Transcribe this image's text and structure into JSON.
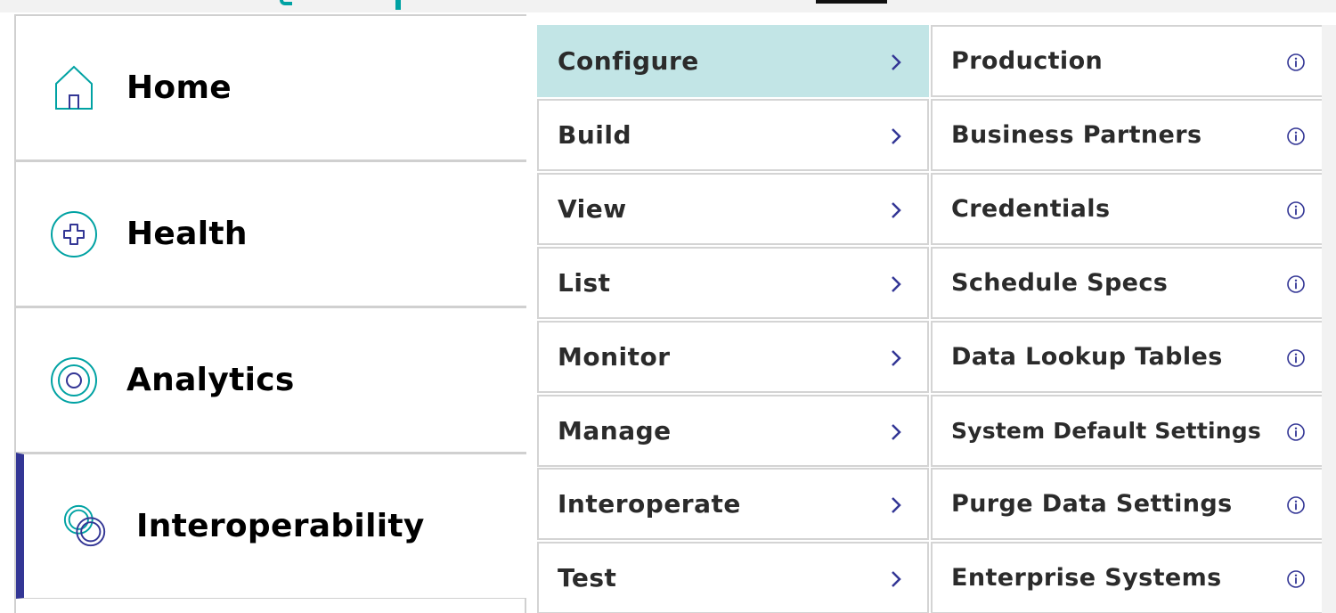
{
  "left_nav": {
    "items": [
      {
        "label": "Home",
        "icon": "home-icon",
        "active": false
      },
      {
        "label": "Health",
        "icon": "health-plus-icon",
        "active": false
      },
      {
        "label": "Analytics",
        "icon": "analytics-target-icon",
        "active": false
      },
      {
        "label": "Interoperability",
        "icon": "interoperability-rings-icon",
        "active": true
      }
    ],
    "active_indicator_color": "#333695"
  },
  "menu": {
    "items": [
      {
        "label": "Configure",
        "selected": true
      },
      {
        "label": "Build",
        "selected": false
      },
      {
        "label": "View",
        "selected": false
      },
      {
        "label": "List",
        "selected": false
      },
      {
        "label": "Monitor",
        "selected": false
      },
      {
        "label": "Manage",
        "selected": false
      },
      {
        "label": "Interoperate",
        "selected": false
      },
      {
        "label": "Test",
        "selected": false
      }
    ],
    "selected_bg": "#c2e5e6",
    "chevron_icon": "chevron-right-icon"
  },
  "submenu": {
    "items": [
      {
        "label": "Production"
      },
      {
        "label": "Business Partners"
      },
      {
        "label": "Credentials"
      },
      {
        "label": "Schedule Specs"
      },
      {
        "label": "Data Lookup Tables"
      },
      {
        "label": "System Default Settings"
      },
      {
        "label": "Purge Data Settings"
      },
      {
        "label": "Enterprise Systems"
      }
    ],
    "info_icon": "info-icon"
  },
  "colors": {
    "teal": "#00a2a3",
    "indigo": "#333695"
  }
}
